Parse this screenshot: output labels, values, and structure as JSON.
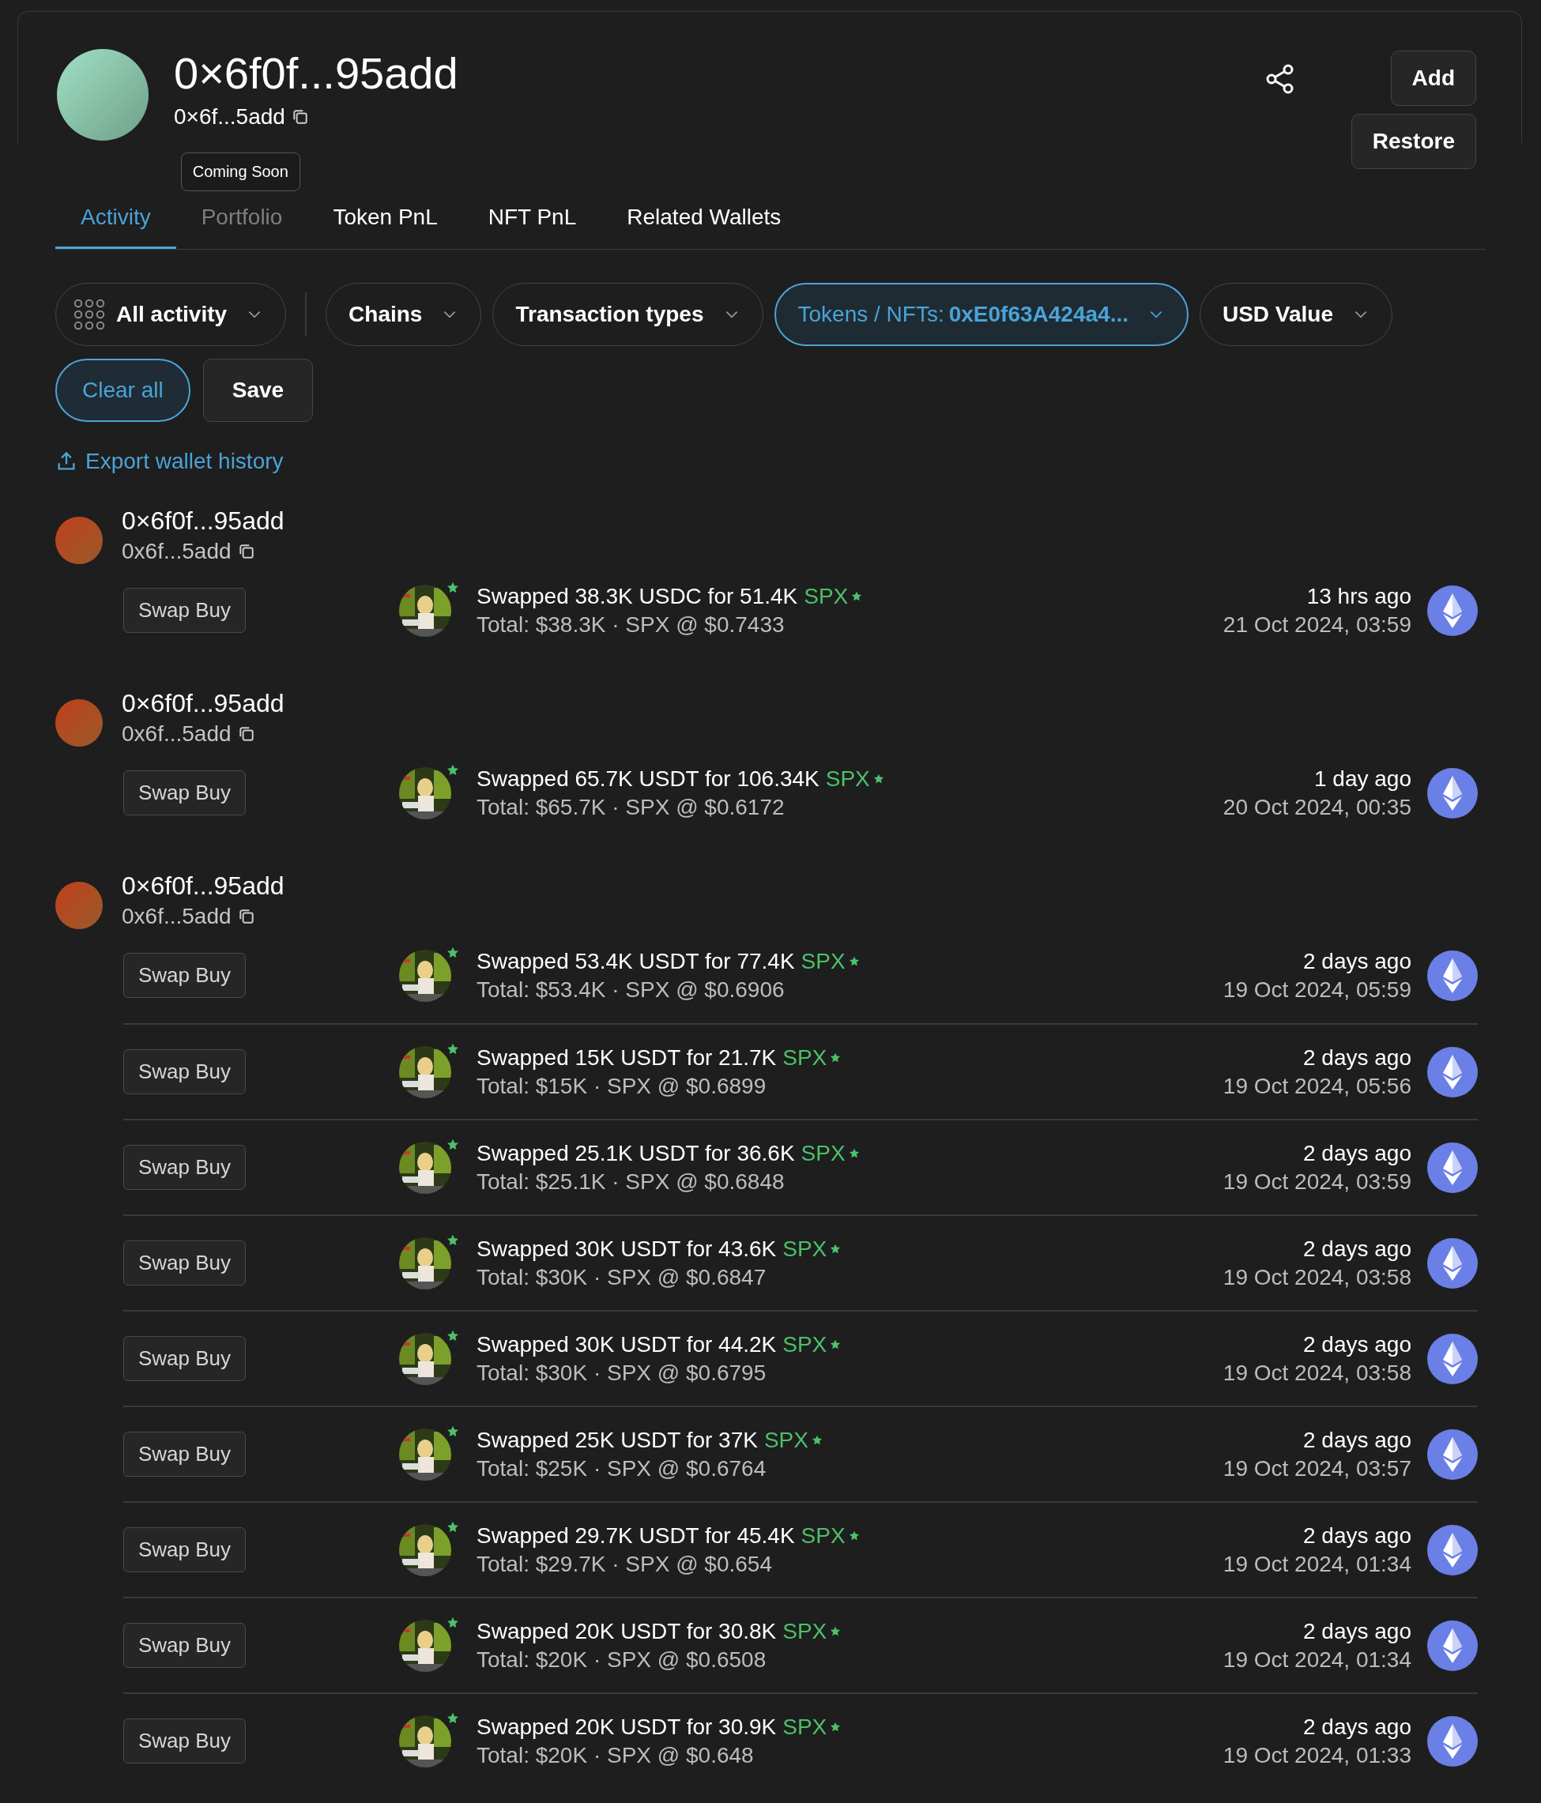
{
  "wallet": {
    "name": "0×6f0f...95add",
    "address": "0×6f...5add"
  },
  "header_buttons": [
    "Add",
    "Restore"
  ],
  "tabs": [
    {
      "label": "Activity",
      "selected": true,
      "disabled": false
    },
    {
      "label": "Portfolio",
      "selected": false,
      "disabled": true,
      "tooltip": "Coming Soon"
    },
    {
      "label": "Token PnL",
      "selected": false,
      "disabled": false
    },
    {
      "label": "NFT PnL",
      "selected": false,
      "disabled": false
    },
    {
      "label": "Related Wallets",
      "selected": false,
      "disabled": false
    }
  ],
  "filters": [
    {
      "kind": "grid",
      "label": "All activity",
      "active": false
    },
    {
      "kind": "plain",
      "label": "Chains",
      "active": false
    },
    {
      "kind": "plain",
      "label": "Transaction types",
      "active": false
    },
    {
      "kind": "plain",
      "label": "Tokens / NFTs:",
      "value": "0xE0f63A424a4...",
      "active": true
    },
    {
      "kind": "plain",
      "label": "USD Value",
      "active": false
    }
  ],
  "filter_actions": [
    {
      "kind": "primary",
      "label": "Clear all"
    },
    {
      "kind": "secondary",
      "label": "Save"
    }
  ],
  "export_link": "Export wallet history",
  "groups": [
    {
      "name": "0×6f0f...95add",
      "address": "0x6f...5add",
      "transactions": [
        {
          "type": "Swap Buy",
          "summary": "Swapped 38.3K USDC for 51.4K",
          "token": "SPX",
          "detail": "Total: $38.3K · SPX @ $0.7433",
          "ago": "13 hrs ago",
          "date": "21 Oct 2024, 03:59"
        }
      ]
    },
    {
      "name": "0×6f0f...95add",
      "address": "0x6f...5add",
      "transactions": [
        {
          "type": "Swap Buy",
          "summary": "Swapped 65.7K USDT for 106.34K",
          "token": "SPX",
          "detail": "Total: $65.7K · SPX @ $0.6172",
          "ago": "1 day ago",
          "date": "20 Oct 2024, 00:35"
        }
      ]
    },
    {
      "name": "0×6f0f...95add",
      "address": "0x6f...5add",
      "transactions": [
        {
          "type": "Swap Buy",
          "summary": "Swapped 53.4K USDT for 77.4K",
          "token": "SPX",
          "detail": "Total: $53.4K · SPX @ $0.6906",
          "ago": "2 days ago",
          "date": "19 Oct 2024, 05:59"
        },
        {
          "type": "Swap Buy",
          "summary": "Swapped 15K USDT for 21.7K",
          "token": "SPX",
          "detail": "Total: $15K · SPX @ $0.6899",
          "ago": "2 days ago",
          "date": "19 Oct 2024, 05:56"
        },
        {
          "type": "Swap Buy",
          "summary": "Swapped 25.1K USDT for 36.6K",
          "token": "SPX",
          "detail": "Total: $25.1K · SPX @ $0.6848",
          "ago": "2 days ago",
          "date": "19 Oct 2024, 03:59"
        },
        {
          "type": "Swap Buy",
          "summary": "Swapped 30K USDT for 43.6K",
          "token": "SPX",
          "detail": "Total: $30K · SPX @ $0.6847",
          "ago": "2 days ago",
          "date": "19 Oct 2024, 03:58"
        },
        {
          "type": "Swap Buy",
          "summary": "Swapped 30K USDT for 44.2K",
          "token": "SPX",
          "detail": "Total: $30K · SPX @ $0.6795",
          "ago": "2 days ago",
          "date": "19 Oct 2024, 03:58"
        },
        {
          "type": "Swap Buy",
          "summary": "Swapped 25K USDT for 37K",
          "token": "SPX",
          "detail": "Total: $25K · SPX @ $0.6764",
          "ago": "2 days ago",
          "date": "19 Oct 2024, 03:57"
        },
        {
          "type": "Swap Buy",
          "summary": "Swapped 29.7K USDT for 45.4K",
          "token": "SPX",
          "detail": "Total: $29.7K · SPX @ $0.654",
          "ago": "2 days ago",
          "date": "19 Oct 2024, 01:34"
        },
        {
          "type": "Swap Buy",
          "summary": "Swapped 20K USDT for 30.8K",
          "token": "SPX",
          "detail": "Total: $20K · SPX @ $0.6508",
          "ago": "2 days ago",
          "date": "19 Oct 2024, 01:34"
        },
        {
          "type": "Swap Buy",
          "summary": "Swapped 20K USDT for 30.9K",
          "token": "SPX",
          "detail": "Total: $20K · SPX @ $0.648",
          "ago": "2 days ago",
          "date": "19 Oct 2024, 01:33"
        }
      ]
    }
  ]
}
